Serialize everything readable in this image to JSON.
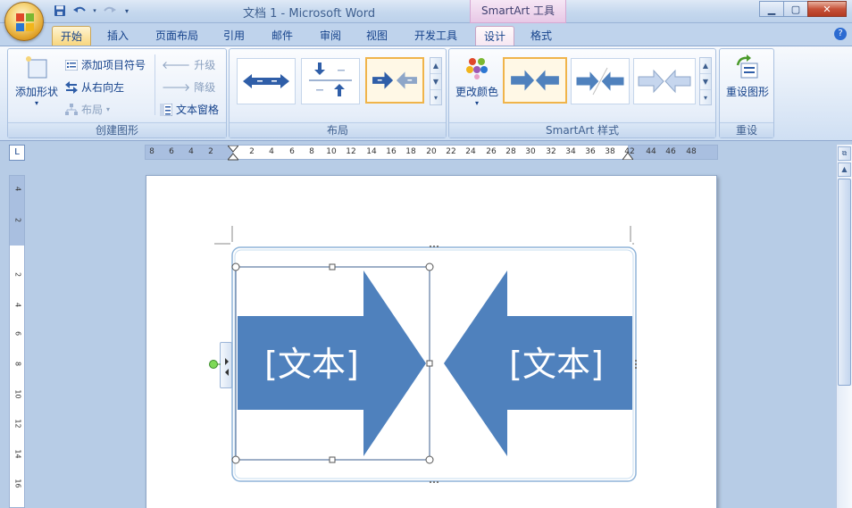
{
  "window": {
    "title": "文档 1 - Microsoft Word",
    "context_tool_title": "SmartArt 工具",
    "controls": {
      "minimize": "▁",
      "maximize": "▢",
      "close": "✕"
    }
  },
  "quick_access": {
    "save_icon": "save-icon",
    "undo_icon": "undo-icon",
    "redo_icon": "redo-icon",
    "customize_icon": "customize-icon"
  },
  "tabs": [
    {
      "label": "开始"
    },
    {
      "label": "插入"
    },
    {
      "label": "页面布局"
    },
    {
      "label": "引用"
    },
    {
      "label": "邮件"
    },
    {
      "label": "审阅"
    },
    {
      "label": "视图"
    },
    {
      "label": "开发工具"
    },
    {
      "label": "设计"
    },
    {
      "label": "格式"
    }
  ],
  "help": "?",
  "ribbon": {
    "create_graphic": {
      "label": "创建图形",
      "add_shape": "添加形状",
      "add_bullet": "添加项目符号",
      "right_to_left": "从右向左",
      "layout": "布局",
      "promote": "升级",
      "demote": "降级",
      "text_pane": "文本窗格"
    },
    "layouts": {
      "label": "布局"
    },
    "styles": {
      "label": "SmartArt 样式",
      "change_colors": "更改颜色"
    },
    "reset": {
      "label": "重设",
      "reset_graphic": "重设图形"
    }
  },
  "ruler": {
    "horizontal_ticks": [
      "8",
      "6",
      "4",
      "2",
      "2",
      "4",
      "6",
      "8",
      "10",
      "12",
      "14",
      "16",
      "18",
      "20",
      "22",
      "24",
      "26",
      "28",
      "30",
      "32",
      "34",
      "36",
      "38",
      "42",
      "44",
      "46",
      "48"
    ],
    "vertical_ticks": [
      "4",
      "2",
      "2",
      "4",
      "6",
      "8",
      "10",
      "12",
      "14",
      "16"
    ]
  },
  "smartart": {
    "left_text": "[文本]",
    "right_text": "[文本]",
    "arrow_color": "#4f81bd"
  },
  "colors": {
    "accent": "#15428b",
    "arrow": "#4f81bd",
    "selected": "#f0b44a"
  }
}
